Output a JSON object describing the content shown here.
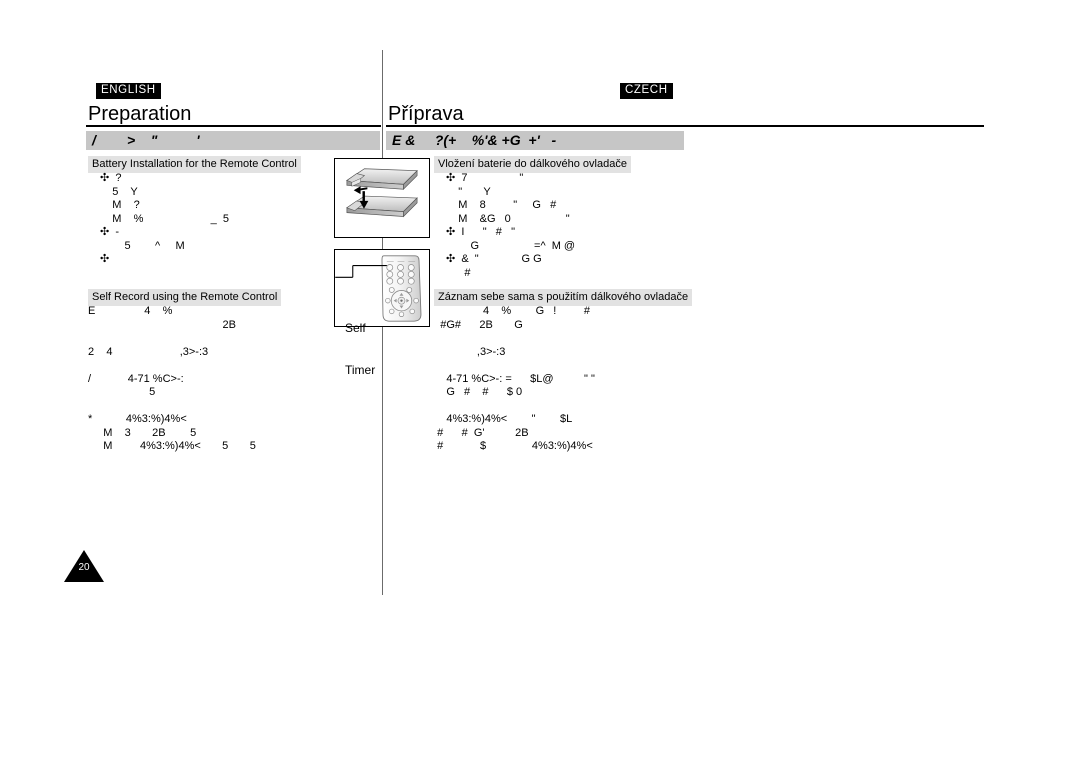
{
  "document": {
    "page_number": "20",
    "languages": {
      "left_tag": "ENGLISH",
      "right_tag": "CZECH"
    }
  },
  "columns": {
    "english": {
      "section_title": "Preparation",
      "banner": "/        >    \"          '",
      "subsections": [
        {
          "heading": "Battery Installation for the Remote Control",
          "body": "✣  ?\n    5    Y\n    M    ?\n    M    %                      _  5\n✣  -\n        5        ^     M\n✣"
        },
        {
          "heading": "Self Record using the Remote Control",
          "body": "E                4    %\n                                            2B\n\n2    4                      ,3>-:3\n\n/            4-71 %C>-:\n                    5\n\n*           4%3:%)4%<\n     M    3       2B        5\n     M         4%3:%)4%<       5       5"
        }
      ]
    },
    "czech": {
      "section_title": "Příprava",
      "banner": "E &     ?(+    %'& +G  +'   -",
      "subsections": [
        {
          "heading": "Vložení baterie do dálkového ovladače",
          "body": "✣  7                 \"\n    \"       Y\n    M    8         \"     G   #\n    M    &G   0                  \"\n✣  I      \"   #   \"\n        G                  =^  M @\n✣  &  \"              G G\n      #"
        },
        {
          "heading": "Záznam sebe sama s použitím dálkového ovladače",
          "body": "                  4    %        G   !         #\n    #G#      2B       G\n\n                ,3>-:3\n\n      4-71 %C>-: =      $L@          \" \"\n      G   #    #      $ 0\n\n      4%3:%)4%<        \"        $L\n   #      #  G'          2B\n   #            $               4%3:%)4%<"
        }
      ]
    }
  },
  "illustrations": {
    "battery": {
      "name": "remote-control-battery-installation"
    },
    "remote": {
      "name": "remote-control-self-timer",
      "callout_line1": "Self",
      "callout_line2": "Timer"
    }
  }
}
